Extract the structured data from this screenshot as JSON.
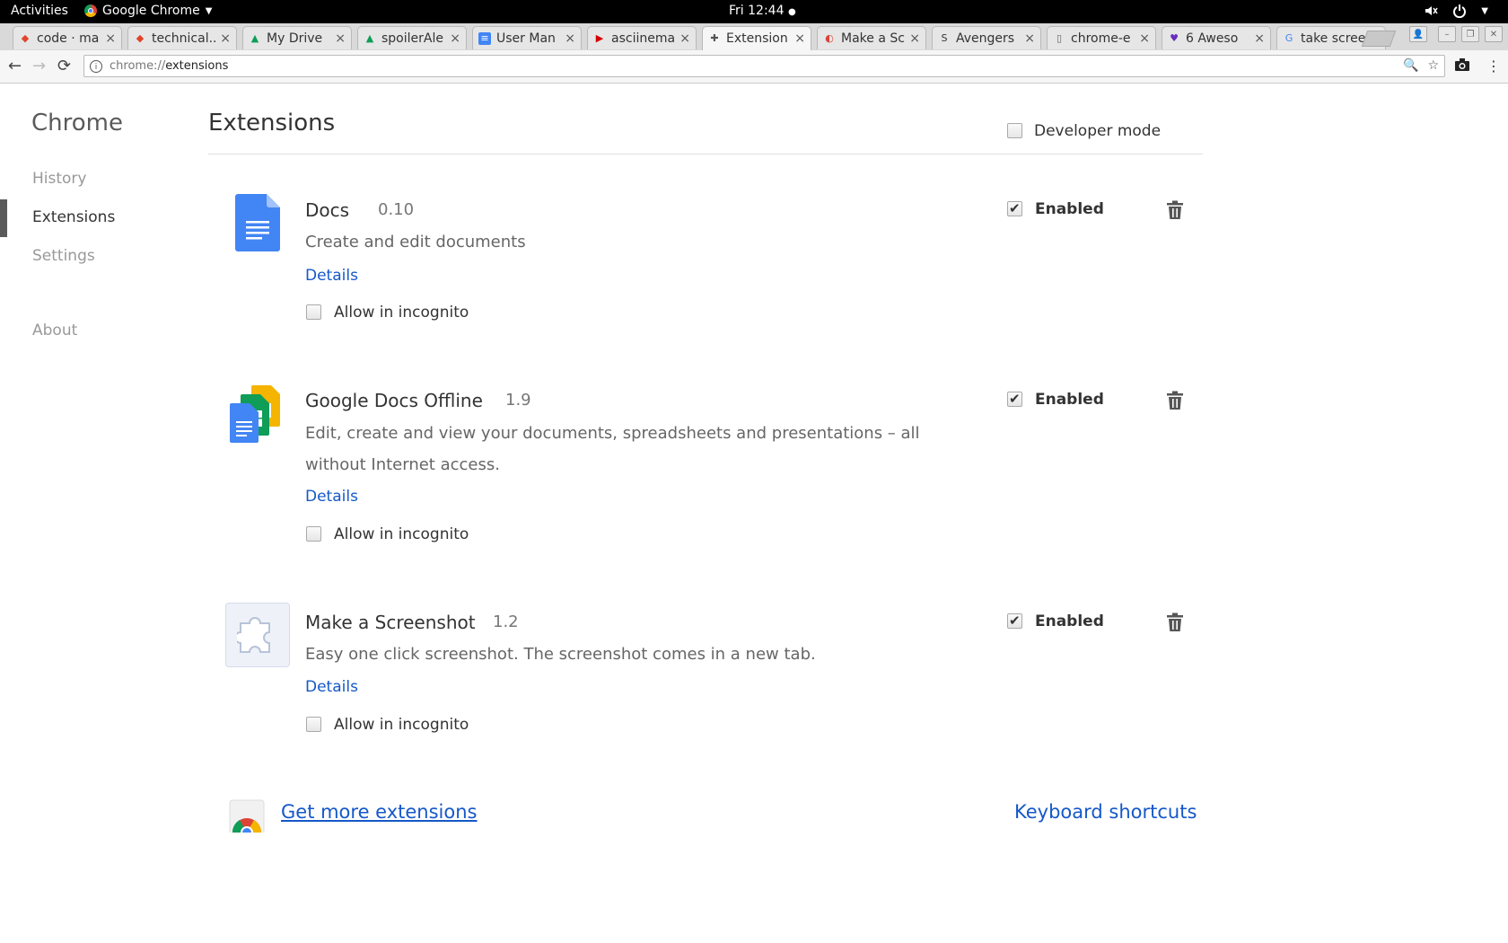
{
  "system_bar": {
    "activities": "Activities",
    "app_menu": "Google Chrome",
    "clock": "Fri 12:44",
    "tray_icons": [
      "volume-icon",
      "power-icon"
    ]
  },
  "tabs": [
    {
      "title": "code · ma",
      "favicon": "gitlab-icon",
      "active": false
    },
    {
      "title": "technical...",
      "favicon": "gitlab-icon",
      "active": false
    },
    {
      "title": "My Drive",
      "favicon": "drive-icon",
      "active": false
    },
    {
      "title": "spoilerAle",
      "favicon": "drive-icon",
      "active": false
    },
    {
      "title": "User Man",
      "favicon": "docs-icon",
      "active": false
    },
    {
      "title": "asciinema",
      "favicon": "asciinema-icon",
      "active": false
    },
    {
      "title": "Extension",
      "favicon": "puzzle-icon",
      "active": true
    },
    {
      "title": "Make a Sc",
      "favicon": "screenshot-icon",
      "active": false
    },
    {
      "title": "Avengers",
      "favicon": "sr-icon",
      "active": false
    },
    {
      "title": "chrome-e",
      "favicon": "page-icon",
      "active": false
    },
    {
      "title": "6 Aweso",
      "favicon": "heart-icon",
      "active": false
    },
    {
      "title": "take scree",
      "favicon": "google-icon",
      "active": false
    }
  ],
  "omnibox": {
    "scheme": "chrome://",
    "host": "extensions"
  },
  "sidebar": {
    "title": "Chrome",
    "items": [
      {
        "label": "History",
        "selected": false
      },
      {
        "label": "Extensions",
        "selected": true
      },
      {
        "label": "Settings",
        "selected": false
      },
      {
        "label": "About",
        "selected": false
      }
    ]
  },
  "header": {
    "title": "Extensions",
    "developer_mode_label": "Developer mode",
    "developer_mode_checked": false
  },
  "extensions": [
    {
      "name": "Docs",
      "version": "0.10",
      "description": "Create and edit documents",
      "details_label": "Details",
      "incognito_label": "Allow in incognito",
      "incognito_checked": false,
      "enabled_label": "Enabled",
      "enabled": true,
      "icon": "docs-icon"
    },
    {
      "name": "Google Docs Offline",
      "version": "1.9",
      "description": "Edit, create and view your documents, spreadsheets and presentations – all without Internet access.",
      "details_label": "Details",
      "incognito_label": "Allow in incognito",
      "incognito_checked": false,
      "enabled_label": "Enabled",
      "enabled": true,
      "icon": "docs-offline-icon"
    },
    {
      "name": "Make a Screenshot",
      "version": "1.2",
      "description": "Easy one click screenshot. The screenshot comes in a new tab.",
      "details_label": "Details",
      "incognito_label": "Allow in incognito",
      "incognito_checked": false,
      "enabled_label": "Enabled",
      "enabled": true,
      "icon": "puzzle-icon"
    }
  ],
  "footer": {
    "get_more_label": "Get more extensions",
    "keyboard_shortcuts_label": "Keyboard shortcuts"
  },
  "colors": {
    "link": "#1558c9",
    "docs_blue": "#4285f4"
  }
}
